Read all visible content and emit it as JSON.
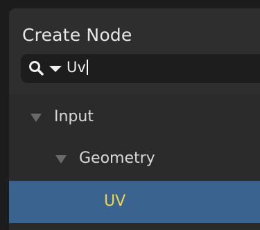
{
  "panel": {
    "title": "Create Node"
  },
  "search": {
    "value": "Uv",
    "icons": [
      "search-icon",
      "chevron-down-icon"
    ]
  },
  "tree": {
    "items": [
      {
        "label": "Input",
        "expanded": true,
        "icon": "triangle-down-icon"
      },
      {
        "label": "Geometry",
        "expanded": true,
        "icon": "triangle-down-icon"
      },
      {
        "label": "UV",
        "selected": true
      }
    ]
  },
  "colors": {
    "panel_bg": "#303030",
    "search_bg": "#1d1d1d",
    "selected_bg": "#3a6390",
    "highlight_text": "#f2d64a"
  }
}
